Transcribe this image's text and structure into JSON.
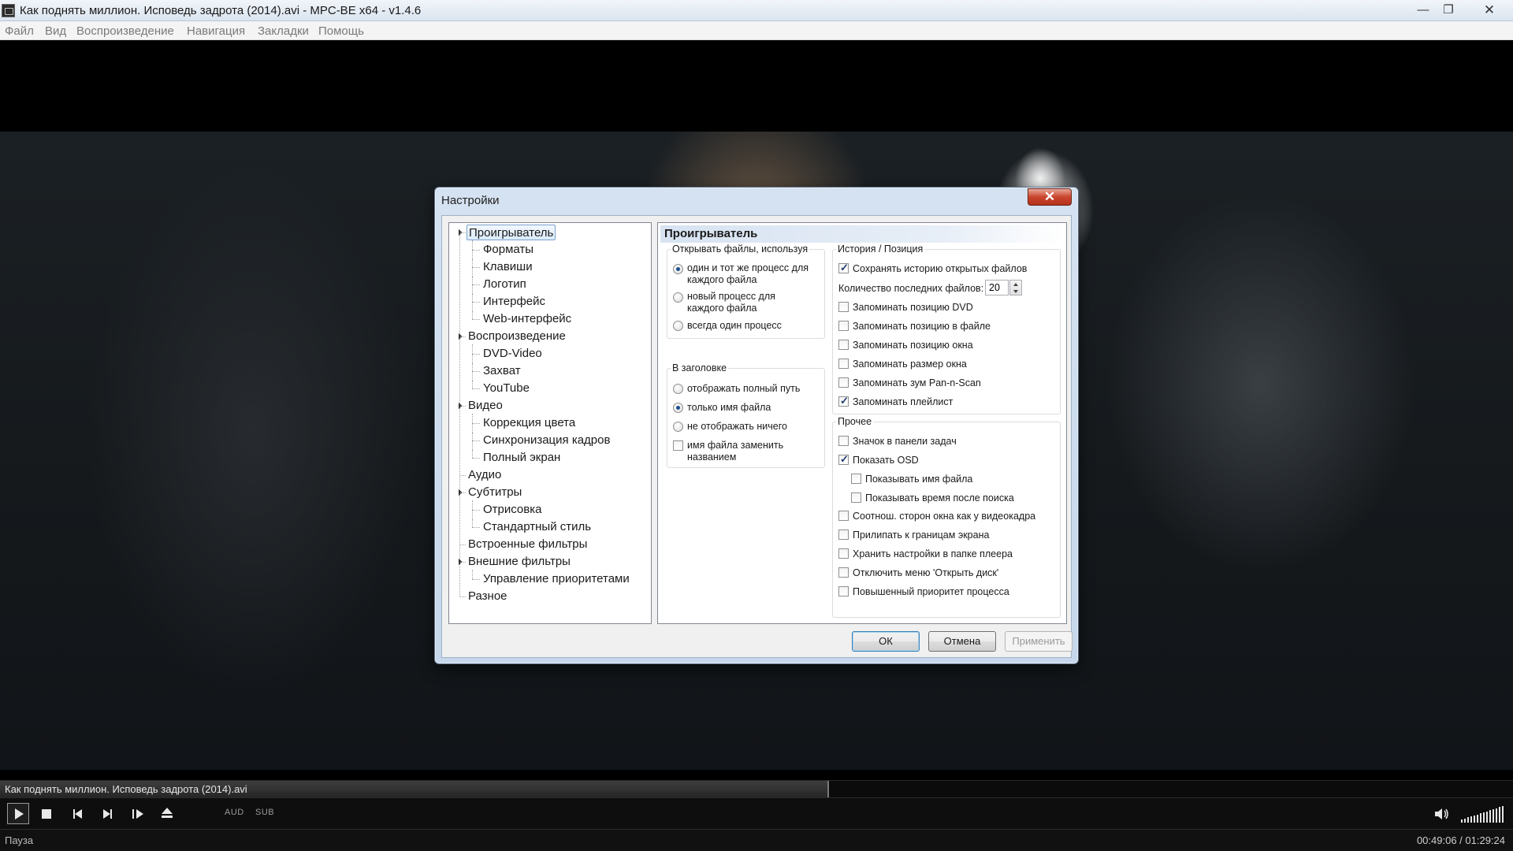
{
  "window": {
    "title": "Как поднять миллион. Исповедь задрота (2014).avi - MPC-BE x64 - v1.4.6",
    "min_icon": "—",
    "max_icon": "❐",
    "close_icon": "✕"
  },
  "menu": [
    "Файл",
    "Вид",
    "Воспроизведение",
    "Навигация",
    "Закладки",
    "Помощь"
  ],
  "player": {
    "file_name": "Как поднять миллион. Исповедь задрота (2014).avi",
    "seek_progress": 0.548,
    "aud_label": "AUD",
    "sub_label": "SUB",
    "status": "Пауза",
    "time": "00:49:06 / 01:29:24"
  },
  "dialog": {
    "title": "Настройки",
    "close_icon": "✕",
    "tree": [
      {
        "label": "Проигрыватель",
        "level": 0,
        "expanded": true,
        "selected": true
      },
      {
        "label": "Форматы",
        "level": 1
      },
      {
        "label": "Клавиши",
        "level": 1
      },
      {
        "label": "Логотип",
        "level": 1
      },
      {
        "label": "Интерфейс",
        "level": 1
      },
      {
        "label": "Web-интерфейс",
        "level": 1
      },
      {
        "label": "Воспроизведение",
        "level": 0,
        "expanded": true
      },
      {
        "label": "DVD-Video",
        "level": 1
      },
      {
        "label": "Захват",
        "level": 1
      },
      {
        "label": "YouTube",
        "level": 1
      },
      {
        "label": "Видео",
        "level": 0,
        "expanded": true
      },
      {
        "label": "Коррекция цвета",
        "level": 1
      },
      {
        "label": "Синхронизация кадров",
        "level": 1
      },
      {
        "label": "Полный экран",
        "level": 1
      },
      {
        "label": "Аудио",
        "level": 0
      },
      {
        "label": "Субтитры",
        "level": 0,
        "expanded": true
      },
      {
        "label": "Отрисовка",
        "level": 1
      },
      {
        "label": "Стандартный стиль",
        "level": 1
      },
      {
        "label": "Встроенные фильтры",
        "level": 0
      },
      {
        "label": "Внешние фильтры",
        "level": 0,
        "expanded": true
      },
      {
        "label": "Управление приоритетами",
        "level": 1
      },
      {
        "label": "Разное",
        "level": 0
      }
    ],
    "page": {
      "header": "Проигрыватель",
      "open_files": {
        "title": "Открывать файлы, используя",
        "options": [
          {
            "label": "один и тот же процесс для\nкаждого файла",
            "checked": true
          },
          {
            "label": "новый процесс для\nкаждого файла",
            "checked": false
          },
          {
            "label": "всегда один процесс",
            "checked": false
          }
        ]
      },
      "title_bar": {
        "title": "В заголовке",
        "options": [
          {
            "label": "отображать полный путь",
            "checked": false
          },
          {
            "label": "только имя файла",
            "checked": true
          },
          {
            "label": "не отображать ничего",
            "checked": false
          }
        ],
        "replace_label": "имя файла заменить\nназванием",
        "replace_checked": false
      },
      "history": {
        "title": "История / Позиция",
        "save_history": {
          "label": "Сохранять историю открытых файлов",
          "checked": true
        },
        "count_label": "Количество последних файлов:",
        "count_value": "20",
        "options": [
          {
            "label": "Запоминать позицию DVD",
            "checked": false
          },
          {
            "label": "Запоминать позицию в файле",
            "checked": false
          },
          {
            "label": "Запоминать позицию окна",
            "checked": false
          },
          {
            "label": "Запоминать размер окна",
            "checked": false
          },
          {
            "label": "Запоминать зум Pan-n-Scan",
            "checked": false
          },
          {
            "label": "Запоминать плейлист",
            "checked": true
          }
        ]
      },
      "other": {
        "title": "Прочее",
        "options": [
          {
            "label": "Значок в панели задач",
            "checked": false,
            "indent": 0
          },
          {
            "label": "Показать OSD",
            "checked": true,
            "indent": 0
          },
          {
            "label": "Показывать имя файла",
            "checked": false,
            "indent": 1
          },
          {
            "label": "Показывать время после поиска",
            "checked": false,
            "indent": 1
          },
          {
            "label": "Соотнош. сторон окна как у видеокадра",
            "checked": false,
            "indent": 0
          },
          {
            "label": "Прилипать к границам экрана",
            "checked": false,
            "indent": 0
          },
          {
            "label": "Хранить настройки в папке плеера",
            "checked": false,
            "indent": 0
          },
          {
            "label": "Отключить меню 'Открыть диск'",
            "checked": false,
            "indent": 0
          },
          {
            "label": "Повышенный приоритет процесса",
            "checked": false,
            "indent": 0
          }
        ]
      }
    },
    "buttons": {
      "ok": "ОК",
      "cancel": "Отмена",
      "apply": "Применить"
    }
  }
}
